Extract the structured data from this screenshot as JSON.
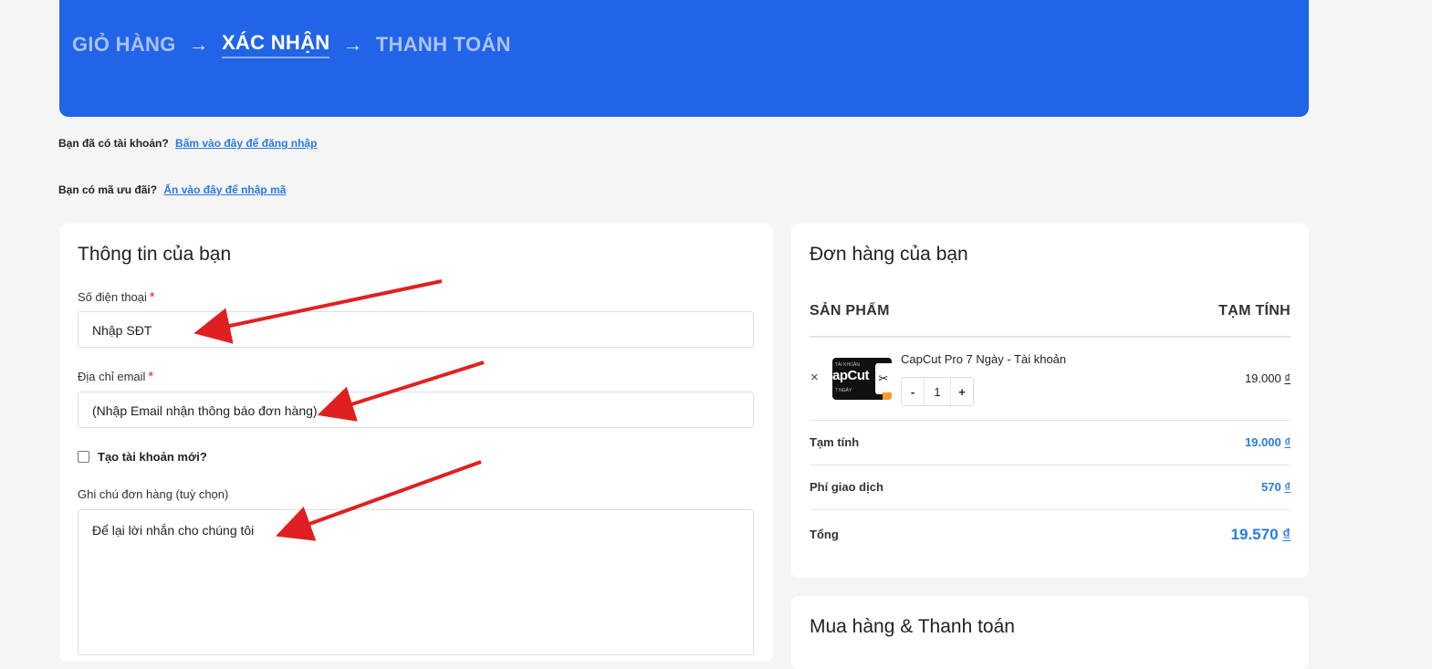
{
  "steps": {
    "cart": "GIỎ HÀNG",
    "confirm": "XÁC NHẬN",
    "payment": "THANH TOÁN",
    "separator": "→"
  },
  "notices": {
    "login_prompt": "Bạn đã có tài khoản?",
    "login_link": "Bấm vào đây để đăng nhập",
    "coupon_prompt": "Bạn có mã ưu đãi?",
    "coupon_link": "Ấn vào đây để nhập mã"
  },
  "billing": {
    "title": "Thông tin của bạn",
    "phone_label": "Số điện thoại",
    "phone_placeholder": "Nhập SĐT",
    "email_label": "Địa chỉ email",
    "email_placeholder": "(Nhập Email nhận thông báo đơn hàng)",
    "required_mark": "*",
    "create_account_label": "Tạo tài khoản mới?",
    "notes_label": "Ghi chú đơn hàng (tuỳ chọn)",
    "notes_placeholder": "Để lại lời nhắn cho chúng tôi"
  },
  "order": {
    "title": "Đơn hàng của bạn",
    "col_product": "SẢN PHẨM",
    "col_subtotal": "TẠM TÍNH",
    "items": [
      {
        "name": "CapCut Pro 7 Ngày - Tài khoản",
        "thumb_top": "TÀI KHOẢN",
        "thumb_brand": "apCut",
        "thumb_bottom": "7 NGÀY",
        "thumb_logo": "✂",
        "remove_icon": "×",
        "qty_minus": "-",
        "qty_value": "1",
        "qty_plus": "+",
        "price": "19.000",
        "currency": "₫"
      }
    ],
    "subtotal_label": "Tạm tính",
    "subtotal_value": "19.000",
    "fee_label": "Phí giao dịch",
    "fee_value": "570",
    "total_label": "Tổng",
    "total_value": "19.570",
    "currency": "₫"
  },
  "payment": {
    "title": "Mua hàng & Thanh toán"
  },
  "colors": {
    "banner": "#2164e8",
    "link": "#2a7ae2",
    "required": "#e02424",
    "annotation_arrow": "#e02020"
  }
}
